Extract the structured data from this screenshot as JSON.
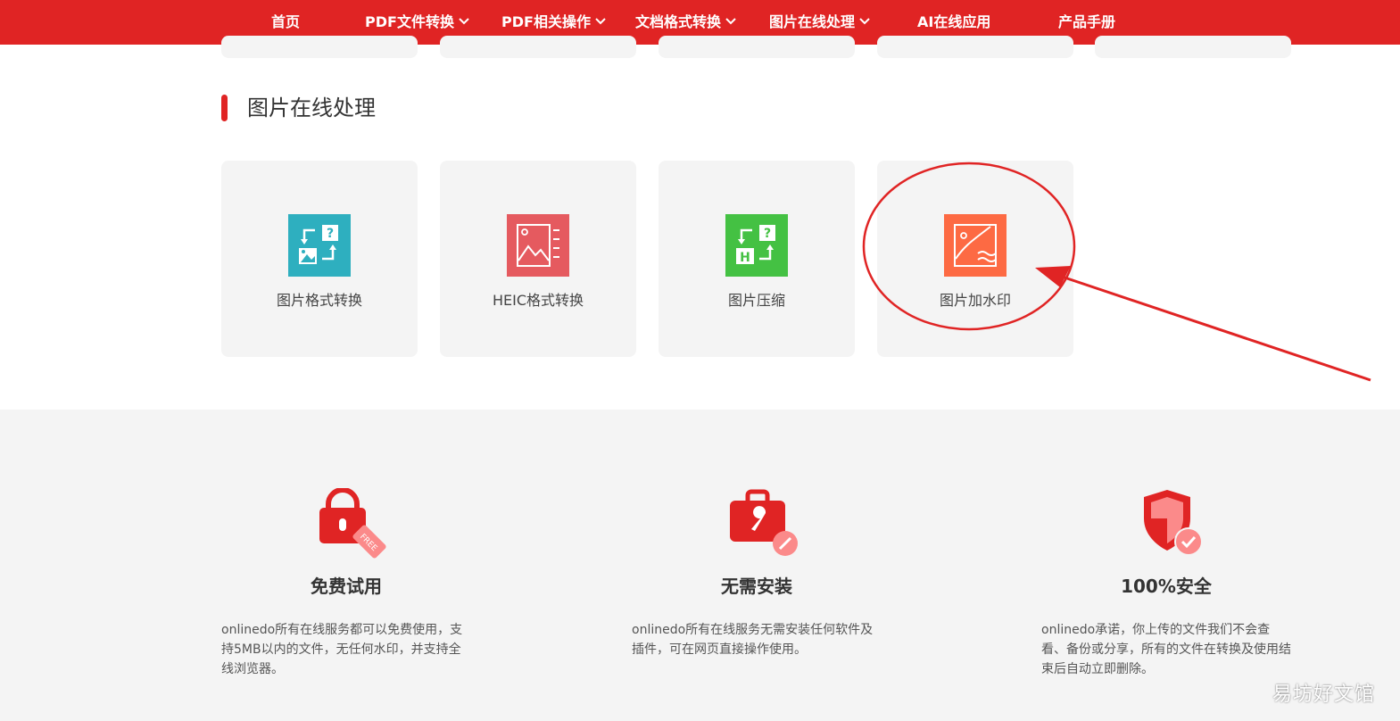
{
  "nav": {
    "items": [
      {
        "label": "首页",
        "dropdown": false
      },
      {
        "label": "PDF文件转换",
        "dropdown": true
      },
      {
        "label": "PDF相关操作",
        "dropdown": true
      },
      {
        "label": "文档格式转换",
        "dropdown": true
      },
      {
        "label": "图片在线处理",
        "dropdown": true
      },
      {
        "label": "AI在线应用",
        "dropdown": false
      },
      {
        "label": "产品手册",
        "dropdown": false
      }
    ]
  },
  "section": {
    "title": "图片在线处理",
    "tools": [
      {
        "label": "图片格式转换",
        "icon": "image-format-convert-icon",
        "color": "#2eafbf"
      },
      {
        "label": "HEIC格式转换",
        "icon": "heic-convert-icon",
        "color": "#e55a5f"
      },
      {
        "label": "图片压缩",
        "icon": "image-compress-icon",
        "color": "#44c143"
      },
      {
        "label": "图片加水印",
        "icon": "image-watermark-icon",
        "color": "#fd6a43"
      }
    ]
  },
  "features": [
    {
      "title": "免费试用",
      "desc": "onlinedo所有在线服务都可以免费使用，支持5MB以内的文件，无任何水印，并支持全线浏览器。",
      "icon": "free-lock-icon",
      "badge": "FREE"
    },
    {
      "title": "无需安装",
      "desc": "onlinedo所有在线服务无需安装任何软件及插件，可在网页直接操作使用。",
      "icon": "toolbox-icon"
    },
    {
      "title": "100%安全",
      "desc": "onlinedo承诺，你上传的文件我们不会查看、备份或分享，所有的文件在转换及使用结束后自动立即删除。",
      "icon": "security-shield-icon"
    }
  ],
  "watermark": "易坊好文馆",
  "colors": {
    "brand": "#e02424",
    "card_bg": "#f4f4f4",
    "annotation": "#e02424"
  }
}
